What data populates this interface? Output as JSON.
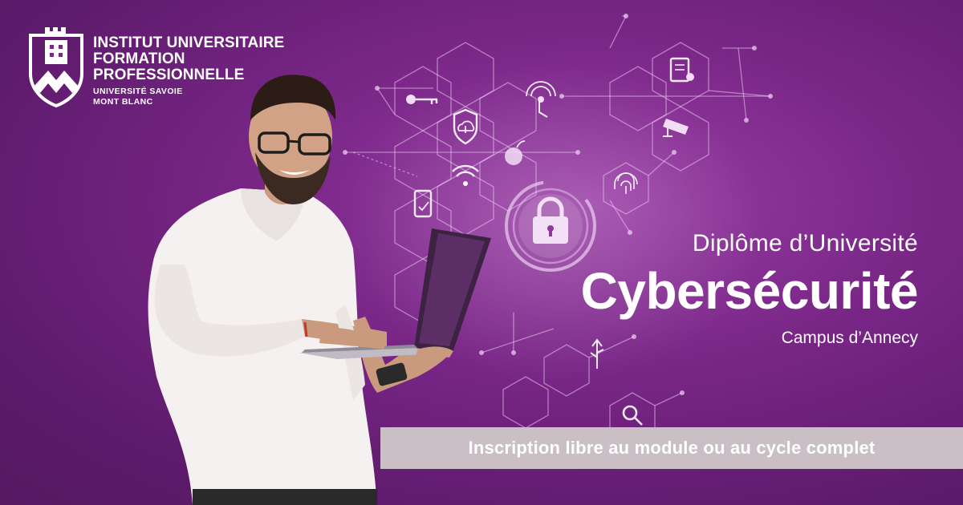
{
  "brand": {
    "name_lines": [
      "INSTITUT UNIVERSITAIRE",
      "FORMATION",
      "PROFESSIONNELLE"
    ],
    "sub_lines": [
      "UNIVERSITÉ SAVOIE",
      "MONT BLANC"
    ],
    "logo_icon": "castle-mountain-shield-icon"
  },
  "headline": {
    "kicker": "Diplôme d’Université",
    "title": "Cybersécurité",
    "campus": "Campus d’Annecy"
  },
  "banner": {
    "text": "Inscription libre au module ou au cycle complet"
  },
  "icons": [
    "key-icon",
    "cloud-upload-shield-icon",
    "touch-signal-icon",
    "document-certificate-icon",
    "security-camera-icon",
    "bomb-icon",
    "wifi-icon",
    "fingerprint-icon",
    "mobile-phone-icon",
    "padlock-icon",
    "usb-icon",
    "search-icon"
  ],
  "colors": {
    "background": "#7a2788",
    "banner": "#c9bfc4",
    "text": "#ffffff"
  }
}
